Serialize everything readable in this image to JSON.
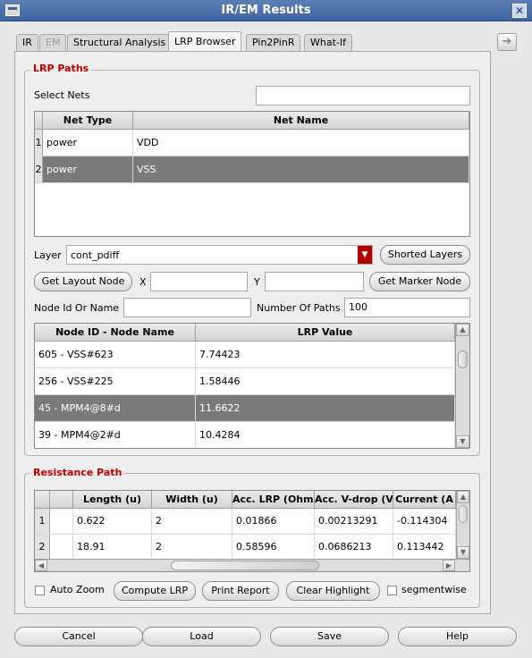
{
  "window": {
    "title": "IR/EM Results"
  },
  "tabs": [
    {
      "label": "IR",
      "state": "normal"
    },
    {
      "label": "EM",
      "state": "disabled"
    },
    {
      "label": "Structural Analysis",
      "state": "normal"
    },
    {
      "label": "LRP Browser",
      "state": "active"
    },
    {
      "label": "Pin2PinR",
      "state": "normal"
    },
    {
      "label": "What-If",
      "state": "normal"
    }
  ],
  "lrp_paths": {
    "title": "LRP Paths",
    "select_nets_label": "Select Nets",
    "select_nets_value": "",
    "nets_table": {
      "columns": [
        "Net Type",
        "Net Name"
      ],
      "rows": [
        {
          "index": "1",
          "net_type": "power",
          "net_name": "VDD",
          "selected": false
        },
        {
          "index": "2",
          "net_type": "power",
          "net_name": "VSS",
          "selected": true
        }
      ]
    },
    "layer_label": "Layer",
    "layer_value": "cont_pdiff",
    "shorted_layers_button": "Shorted Layers",
    "get_layout_node_button": "Get Layout Node",
    "x_label": "X",
    "x_value": "",
    "y_label": "Y",
    "y_value": "",
    "get_marker_node_button": "Get Marker Node",
    "node_id_label": "Node Id Or Name",
    "node_id_value": "",
    "num_paths_label": "Number Of Paths",
    "num_paths_value": "100",
    "nodes_table": {
      "columns": [
        "Node ID - Node Name",
        "LRP Value"
      ],
      "rows": [
        {
          "node": "605 - VSS#623",
          "value": "7.74423",
          "selected": false
        },
        {
          "node": "256 - VSS#225",
          "value": "1.58446",
          "selected": false
        },
        {
          "node": "45 - MPM4@8#d",
          "value": "11.6622",
          "selected": true
        },
        {
          "node": "39 - MPM4@2#d",
          "value": "10.4284",
          "selected": false
        }
      ]
    }
  },
  "resistance_path": {
    "title": "Resistance Path",
    "table": {
      "columns": [
        "",
        "Length (u)",
        "Width (u)",
        "Acc. LRP (Ohm",
        "Acc. V-drop (V)",
        "Current (A"
      ],
      "rows": [
        {
          "index": "1",
          "c0": "",
          "length": "0.622",
          "width": "2",
          "acc_lrp": "0.01866",
          "acc_vdrop": "0.00213291",
          "current": "-0.114304"
        },
        {
          "index": "2",
          "c0": "",
          "length": "18.91",
          "width": "2",
          "acc_lrp": "0.58596",
          "acc_vdrop": "0.0686213",
          "current": "0.113442"
        }
      ]
    },
    "auto_zoom_label": "Auto Zoom",
    "auto_zoom_checked": false,
    "compute_lrp_button": "Compute LRP",
    "print_report_button": "Print Report",
    "clear_highlight_button": "Clear Highlight",
    "segmentwise_label": "segmentwise",
    "segmentwise_checked": false
  },
  "footer": {
    "cancel": "Cancel",
    "load": "Load",
    "save": "Save",
    "help": "Help"
  },
  "icons": {
    "window_menu": "window-menu-icon",
    "close": "close-icon",
    "side_panel": "arrow-right-icon",
    "dropdown": "chevron-down-icon"
  },
  "colors": {
    "title_bar": "#4a6fa8",
    "group_title": "#c00000",
    "selected_row": "#7a7a7a",
    "dropdown_accent": "#b00000"
  }
}
